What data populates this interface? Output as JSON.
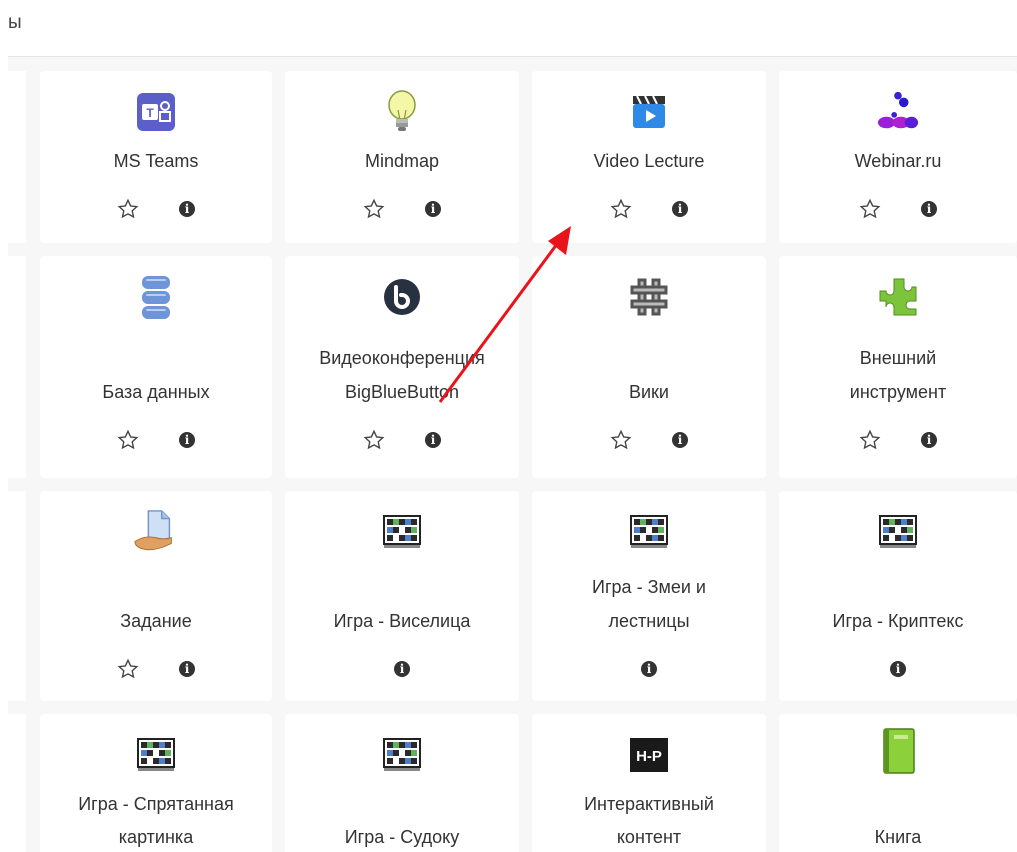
{
  "header": {
    "text": "ы"
  },
  "cards": [
    {
      "name": "MS Teams",
      "icon": "ms-teams-icon"
    },
    {
      "name": "Mindmap",
      "icon": "lightbulb-icon"
    },
    {
      "name": "Video Lecture",
      "icon": "video-lecture-icon"
    },
    {
      "name": "Webinar.ru",
      "icon": "webinar-icon"
    },
    {
      "name": "База данных",
      "icon": "database-icon"
    },
    {
      "name_lines": [
        "Видеоконференция",
        "BigBlueButton"
      ],
      "icon": "bigbluebutton-icon"
    },
    {
      "name": "Вики",
      "icon": "wiki-icon"
    },
    {
      "name_lines": [
        "Внешний",
        "инструмент"
      ],
      "icon": "puzzle-icon"
    },
    {
      "name": "Задание",
      "icon": "assignment-icon"
    },
    {
      "name": "Игра - Виселица",
      "icon": "game-grid-icon"
    },
    {
      "name_lines": [
        "Игра - Змеи и",
        "лестницы"
      ],
      "icon": "game-grid-icon"
    },
    {
      "name": "Игра - Криптекс",
      "icon": "game-grid-icon"
    },
    {
      "name_lines": [
        "Игра - Спрятанная",
        "картинка"
      ],
      "icon": "game-grid-icon"
    },
    {
      "name": "Игра - Судоку",
      "icon": "game-grid-icon"
    },
    {
      "name_lines": [
        "Интерактивный",
        "контент"
      ],
      "icon": "h5p-icon"
    },
    {
      "name": "Книга",
      "icon": "book-icon"
    }
  ],
  "colors": {
    "annotation_arrow": "#e8141a",
    "card_bg": "#ffffff",
    "grid_bg": "#f7f7f7"
  }
}
